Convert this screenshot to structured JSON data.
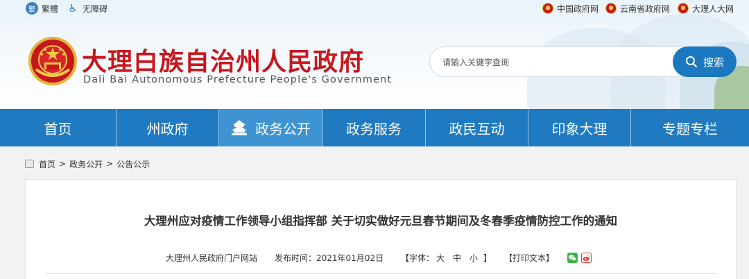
{
  "topbar": {
    "traditional_label": "繁體",
    "accessibility_label": "无障碍",
    "links": [
      {
        "label": "中国政府网"
      },
      {
        "label": "云南省政府网"
      },
      {
        "label": "大理人大网"
      }
    ]
  },
  "site": {
    "title": "大理白族自治州人民政府",
    "subtitle": "Dali Bai Autonomous Prefecture People's Government"
  },
  "search": {
    "placeholder": "请输入关键字查询",
    "button_label": "搜索"
  },
  "nav": {
    "items": [
      {
        "label": "首页"
      },
      {
        "label": "州政府"
      },
      {
        "label": "政务公开",
        "active": true
      },
      {
        "label": "政务服务"
      },
      {
        "label": "政民互动"
      },
      {
        "label": "印象大理"
      },
      {
        "label": "专题专栏"
      }
    ]
  },
  "breadcrumb": {
    "items": [
      "首页",
      "政务公开",
      "公告公示"
    ],
    "separator": ">"
  },
  "article": {
    "title": "大理州应对疫情工作领导小组指挥部 关于切实做好元旦春节期间及冬春季疫情防控工作的通知",
    "source": "大理州人民政府门户网站",
    "publish_label": "发布时间：",
    "publish_date": "2021年01月02日",
    "font_label": "【字体：",
    "font_large": "大",
    "font_medium": "中",
    "font_small": "小",
    "font_close": "】",
    "print_label": "【打印文本】"
  },
  "colors": {
    "brand_red": "#c8161d",
    "nav_blue": "#1f7ac1",
    "nav_active": "#3e93d3",
    "search_btn": "#1c78c0",
    "wechat_green": "#3bb34a",
    "weibo_red": "#e2362b"
  }
}
